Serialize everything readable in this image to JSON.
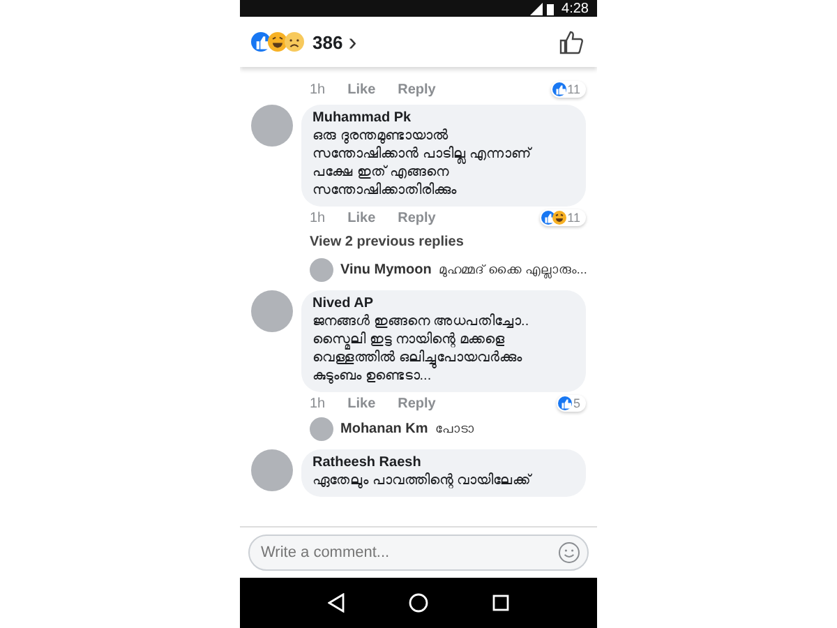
{
  "status_bar": {
    "time": "4:28"
  },
  "reactions_header": {
    "reactions": [
      {
        "kind": "like"
      },
      {
        "kind": "haha"
      },
      {
        "kind": "sad"
      }
    ],
    "count": "386",
    "chevron": "›"
  },
  "comments": [
    {
      "kind": "actions_only",
      "time": "1h",
      "like": "Like",
      "reply": "Reply",
      "reactions": [
        {
          "kind": "like"
        }
      ],
      "reaction_count": "11"
    },
    {
      "kind": "comment",
      "author": "Muhammad Pk",
      "lines": [
        "ഒരു ദുരന്തമുണ്ടായാൽ",
        "സന്തോഷിക്കാൻ പാടില്ല എന്നാണ്",
        "പക്ഷേ ഇത് എങ്ങനെ",
        "സന്തോഷിക്കാതിരിക്കും"
      ],
      "time": "1h",
      "like": "Like",
      "reply": "Reply",
      "reactions": [
        {
          "kind": "like"
        },
        {
          "kind": "haha"
        }
      ],
      "reaction_count": "11"
    },
    {
      "kind": "more_replies",
      "label": "View 2 previous replies"
    },
    {
      "kind": "reply_preview",
      "author": "Vinu Mymoon",
      "text": "മുഹമ്മദ് ക്കൈ എല്ലാരും..."
    },
    {
      "kind": "comment",
      "author": "Nived AP",
      "lines": [
        "ജനങ്ങൾ ഇങ്ങനെ അധപതിച്ചോ..",
        "സ്മൈലി ഇട്ട നായിന്റെ മക്കളെ",
        "വെള്ളത്തിൽ ഒലിച്ചുപോയവർക്കും",
        "കുടുംബം ഉണ്ടെടാ..."
      ],
      "time": "1h",
      "like": "Like",
      "reply": "Reply",
      "reactions": [
        {
          "kind": "like"
        }
      ],
      "reaction_count": "5"
    },
    {
      "kind": "reply_preview",
      "author": "Mohanan Km",
      "text": "പോടാ"
    },
    {
      "kind": "comment",
      "author": "Ratheesh Raesh",
      "lines": [
        "ഏതേലും പാവത്തിന്റെ വായിലേക്ക്"
      ]
    }
  ],
  "composer": {
    "placeholder": "Write a comment..."
  }
}
